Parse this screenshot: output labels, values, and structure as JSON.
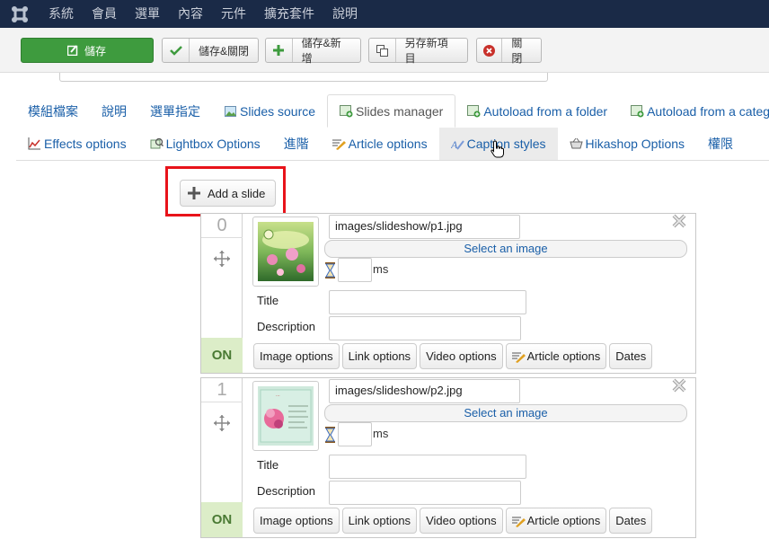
{
  "topbar": {
    "logo_icon": "joomla-logo-icon",
    "menu": [
      "系統",
      "會員",
      "選單",
      "內容",
      "元件",
      "擴充套件",
      "說明"
    ]
  },
  "toolbar": {
    "save": "儲存",
    "save_close": "儲存&關閉",
    "save_new": "儲存&新增",
    "save_copy": "另存新項目",
    "close": "關閉",
    "colors": {
      "save_bg": "#3e9b3e",
      "plus": "#3e9b3e",
      "close": "#c8302a"
    }
  },
  "tabs_row1": [
    "模組檔案",
    "說明",
    "選單指定",
    "Slides source",
    "Slides manager",
    "Autoload from a folder",
    "Autoload from a category o"
  ],
  "tabs_row2": [
    "Effects options",
    "Lightbox Options",
    "進階",
    "Article options",
    "Caption styles",
    "Hikashop Options",
    "權限"
  ],
  "add_slide": "Add a slide",
  "slides": [
    {
      "index": "0",
      "path": "images/slideshow/p1.jpg",
      "select_image": "Select an image",
      "ms": "ms",
      "title_label": "Title",
      "description_label": "Description",
      "status": "ON",
      "options": [
        "Image options",
        "Link options",
        "Video options",
        "Article options",
        "Dates"
      ]
    },
    {
      "index": "1",
      "path": "images/slideshow/p2.jpg",
      "select_image": "Select an image",
      "ms": "ms",
      "title_label": "Title",
      "description_label": "Description",
      "status": "ON",
      "options": [
        "Image options",
        "Link options",
        "Video options",
        "Article options",
        "Dates"
      ]
    }
  ],
  "accent": {
    "highlight_box": "#e8131a",
    "link": "#1a5fa8",
    "on_bg": "#dcedc8",
    "topbar_bg": "#1a2a47"
  }
}
